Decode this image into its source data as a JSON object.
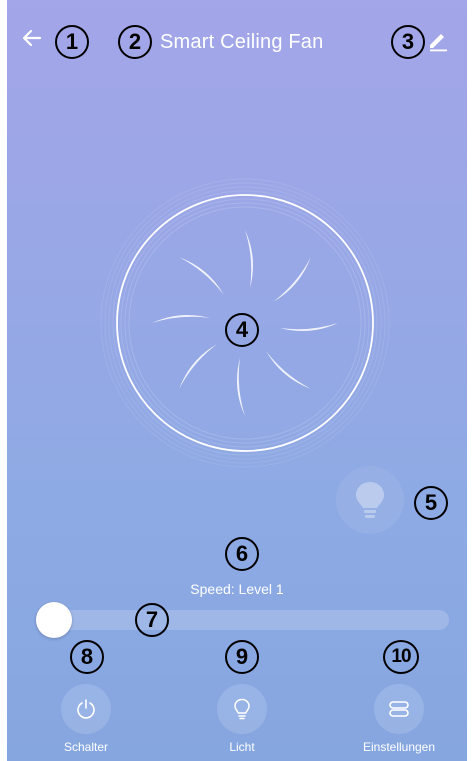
{
  "header": {
    "title": "Smart Ceiling Fan",
    "back_icon": "arrow-left-icon",
    "edit_icon": "pencil-icon"
  },
  "fan": {
    "icon": "fan-blades-icon"
  },
  "light_toggle": {
    "icon": "lightbulb-icon"
  },
  "speed": {
    "label": "Speed: Level 1",
    "level_fraction": 0.0
  },
  "controls": [
    {
      "label": "Schalter",
      "icon": "power-icon"
    },
    {
      "label": "Licht",
      "icon": "lightbulb-outline-icon"
    },
    {
      "label": "Einstellungen",
      "icon": "settings-toggle-icon"
    }
  ],
  "markers": [
    "1",
    "2",
    "3",
    "4",
    "5",
    "6",
    "7",
    "8",
    "9",
    "10"
  ]
}
